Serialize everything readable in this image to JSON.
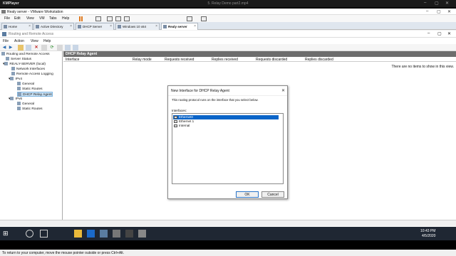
{
  "kmplayer": {
    "logo": "KMPlayer",
    "title": "5. Relay Demo part2.mp4"
  },
  "vmware": {
    "title": "Realy server - VMware Workstation",
    "menu": [
      "File",
      "Edit",
      "View",
      "VM",
      "Tabs",
      "Help"
    ],
    "tabs": [
      "Home",
      "Active Directory",
      "DHCP Server",
      "Windows 10 x64",
      "Realy server"
    ],
    "status": "To return to your computer, move the mouse pointer outside or press Ctrl+Alt."
  },
  "rra": {
    "title": "Routing and Remote Access",
    "menu": [
      "File",
      "Action",
      "View",
      "Help"
    ],
    "tree": [
      "Routing and Remote Access",
      "Server Status",
      "REALY-SERVER (local)",
      "Network Interfaces",
      "Remote Access Logging",
      "IPv4",
      "General",
      "Static Routes",
      "DHCP Relay Agent",
      "IPv6",
      "General",
      "Static Routes"
    ],
    "pane_title": "DHCP Relay Agent",
    "columns": [
      "Interface",
      "Relay mode",
      "Requests received",
      "Replies received",
      "Requests discarded",
      "Replies discarded"
    ],
    "empty_message": "There are no items to show in this view."
  },
  "dialog": {
    "title": "New Interface for DHCP Relay Agent",
    "description": "This routing protocol runs on the interface that you select below.",
    "interfaces_label": "Interfaces:",
    "interfaces": [
      "Ethernet0",
      "Ethernet 1",
      "Internal"
    ],
    "selected_index": 0,
    "ok_label": "OK",
    "cancel_label": "Cancel"
  },
  "taskbar": {
    "time": "10:43 PM",
    "date": "4/5/2020"
  },
  "colors": {
    "selection": "#0a64c8",
    "taskbar": "#1f2733",
    "pane_header": "#6d6d6d"
  }
}
